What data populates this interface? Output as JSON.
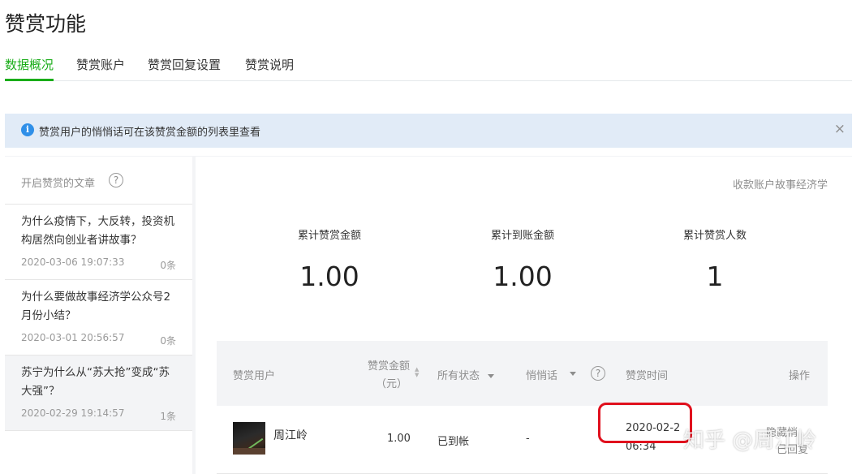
{
  "page": {
    "title": "赞赏功能"
  },
  "tabs": [
    {
      "label": "数据概况",
      "active": true
    },
    {
      "label": "赞赏账户",
      "active": false
    },
    {
      "label": "赞赏回复设置",
      "active": false
    },
    {
      "label": "赞赏说明",
      "active": false
    }
  ],
  "notice": {
    "text": "赞赏用户的悄悄话可在该赞赏金额的列表里查看",
    "info_icon": "i",
    "close_icon": "×"
  },
  "articles": {
    "header": "开启赞赏的文章",
    "help_icon": "?",
    "items": [
      {
        "title": "为什么疫情下，大反转，投资机构居然向创业者讲故事？",
        "date": "2020-03-06 19:07:33",
        "count": "0条",
        "selected": false
      },
      {
        "title": "为什么要做故事经济学公众号2月份小结？",
        "date": "2020-03-01 20:56:57",
        "count": "0条",
        "selected": false
      },
      {
        "title": "苏宁为什么从“苏大抢”变成“苏大强”？",
        "date": "2020-02-29 19:14:57",
        "count": "1条",
        "selected": true
      }
    ]
  },
  "summary": {
    "account": "收款账户故事经济学",
    "stats": [
      {
        "label": "累计赞赏金额",
        "value": "1.00"
      },
      {
        "label": "累计到账金额",
        "value": "1.00"
      },
      {
        "label": "累计赞赏人数",
        "value": "1"
      }
    ]
  },
  "table": {
    "headers": {
      "user": "赞赏用户",
      "amount_line1": "赞赏金额",
      "amount_line2": "（元）",
      "status": "所有状态",
      "whisper": "悄悄话",
      "whisper_help": "?",
      "time": "赞赏时间",
      "action": "操作"
    },
    "rows": [
      {
        "user": "周江岭",
        "amount": "1.00",
        "status": "已到帐",
        "whisper": "-",
        "time_line1": "2020-02-2",
        "time_line2": "06:34",
        "action_line1": "隐藏悄",
        "action_line2": "已回复"
      }
    ]
  },
  "watermark": "知乎 @周江岭",
  "colors": {
    "accent": "#1aad19",
    "notice_bg": "#e1ebf7",
    "info_blue": "#2f8fe8",
    "annotation_red": "#e0101d"
  }
}
